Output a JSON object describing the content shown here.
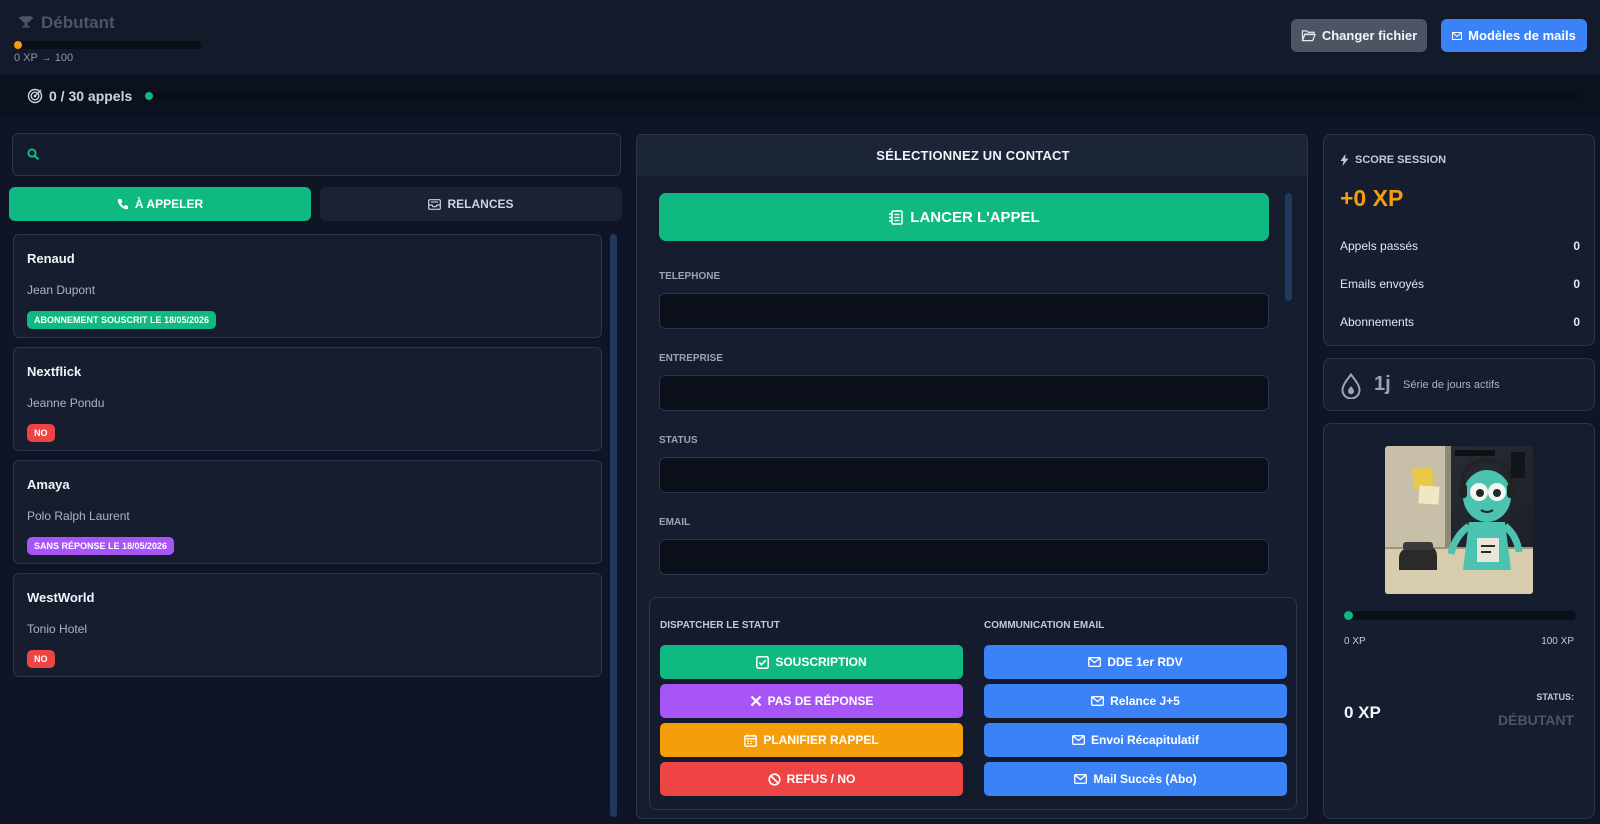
{
  "header": {
    "level_name": "Débutant",
    "xp_progress_text": "0 XP → 100",
    "xp_progress_fraction": 0.0,
    "change_file_label": "Changer fichier",
    "mail_templates_label": "Modèles de mails"
  },
  "calls_progress": {
    "label": "0 / 30 appels",
    "done": 0,
    "total": 30
  },
  "search": {
    "placeholder": ""
  },
  "tabs": {
    "to_call": "À APPELER",
    "followups": "RELANCES"
  },
  "contacts": [
    {
      "company": "Renaud",
      "person": "Jean Dupont",
      "badge": "ABONNEMENT SOUSCRIT LE 18/05/2026",
      "badge_color": "#10b981"
    },
    {
      "company": "Nextflick",
      "person": "Jeanne Pondu",
      "badge": "NO",
      "badge_color": "#ef4444"
    },
    {
      "company": "Amaya",
      "person": "Polo Ralph Laurent",
      "badge": "SANS RÉPONSE LE 18/05/2026",
      "badge_color": "#a855f7"
    },
    {
      "company": "WestWorld",
      "person": "Tonio Hotel",
      "badge": "NO",
      "badge_color": "#ef4444"
    }
  ],
  "detail": {
    "title": "SÉLECTIONNEZ UN CONTACT",
    "launch_label": "LANCER L'APPEL",
    "fields": {
      "telephone": {
        "label": "TELEPHONE",
        "value": ""
      },
      "entreprise": {
        "label": "ENTREPRISE",
        "value": ""
      },
      "status": {
        "label": "STATUS",
        "value": ""
      },
      "email": {
        "label": "EMAIL",
        "value": ""
      }
    },
    "dispatch_title": "DISPATCHER LE STATUT",
    "email_title": "COMMUNICATION EMAIL",
    "status_buttons": {
      "souscription": "SOUSCRIPTION",
      "no_answer": "PAS DE RÉPONSE",
      "reminder": "PLANIFIER RAPPEL",
      "refusal": "REFUS / NO"
    },
    "email_buttons": {
      "first_meeting": "DDE 1er RDV",
      "followup": "Relance J+5",
      "recap": "Envoi Récapitulatif",
      "success": "Mail Succès (Abo)"
    }
  },
  "session": {
    "title": "SCORE SESSION",
    "xp": "+0 XP",
    "stats": {
      "calls_label": "Appels passés",
      "calls_value": "0",
      "emails_label": "Emails envoyés",
      "emails_value": "0",
      "subs_label": "Abonnements",
      "subs_value": "0"
    }
  },
  "streak": {
    "value": "1j",
    "label": "Série de jours actifs"
  },
  "profile": {
    "xp_min_label": "0 XP",
    "xp_max_label": "100 XP",
    "xp_fraction": 0.0,
    "xp_total": "0 XP",
    "status_label": "STATUS:",
    "status_value": "DÉBUTANT"
  },
  "colors": {
    "accent_green": "#10b981",
    "accent_blue": "#3b82f6",
    "accent_purple": "#a855f7",
    "accent_orange": "#f59e0b",
    "accent_red": "#ef4444"
  }
}
